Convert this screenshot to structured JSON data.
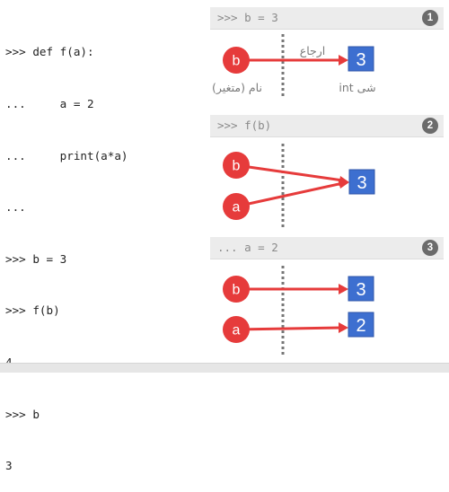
{
  "code_lines": [
    ">>> def f(a):",
    "...     a = 2",
    "...     print(a*a)",
    "...",
    ">>> b = 3",
    ">>> f(b)",
    "4",
    ">>> b",
    "3"
  ],
  "panels": [
    {
      "code": ">>> b = 3",
      "number": "1",
      "variables": [
        "b"
      ],
      "objects": [
        "3"
      ],
      "labels": {
        "variable": "نام (متغیر)",
        "object": "شی int",
        "reference": "ارجاع"
      }
    },
    {
      "code": ">>> f(b)",
      "number": "2",
      "variables": [
        "b",
        "a"
      ],
      "objects": [
        "3"
      ]
    },
    {
      "code": "... a = 2",
      "number": "3",
      "variables": [
        "b",
        "a"
      ],
      "objects": [
        "3",
        "2"
      ]
    }
  ],
  "colors": {
    "variable": "#e63b3b",
    "object": "#3d6fd0",
    "arrow": "#e63b3b",
    "header_bg": "#ececec",
    "badge_bg": "#6b6b6b"
  }
}
